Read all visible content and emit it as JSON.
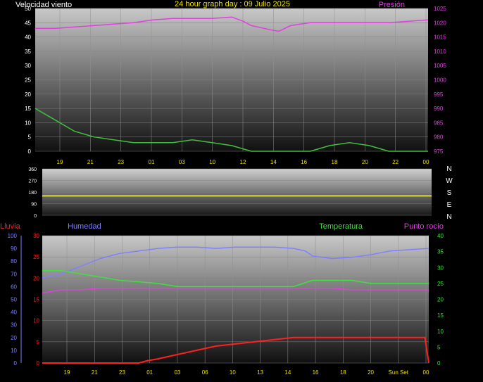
{
  "header": {
    "title": "24 hour graph day : 09 Julio 2025"
  },
  "colors": {
    "wind_label": "#ffffff",
    "pressure": "#e040e0",
    "tick_yellow": "#e8e000",
    "humidity": "#8080ff",
    "temperature": "#40e040",
    "dew": "#e040e0",
    "rain": "#ff2020",
    "direction": "#ffff60"
  },
  "x_ticks": [
    "19",
    "21",
    "23",
    "01",
    "03",
    "10",
    "12",
    "14",
    "16",
    "18",
    "20",
    "22",
    "00"
  ],
  "x_ticks_bottom": [
    "19",
    "21",
    "23",
    "01",
    "03",
    "06",
    "10",
    "13",
    "14",
    "16",
    "18",
    "20",
    "Sun Set",
    "00"
  ],
  "chart_data": [
    {
      "type": "line",
      "name": "wind_pressure",
      "left_label": "Velocidad viento",
      "right_label": "Presión",
      "left_ticks": [
        "0",
        "5",
        "10",
        "15",
        "20",
        "25",
        "30",
        "35",
        "40",
        "45",
        "50"
      ],
      "right_ticks": [
        "975",
        "980",
        "985",
        "990",
        "995",
        "1000",
        "1005",
        "1010",
        "1015",
        "1020",
        "1025"
      ],
      "ylim_left": [
        0,
        50
      ],
      "ylim_right": [
        975,
        1025
      ],
      "series": [
        {
          "axis": "right",
          "color": "#e040e0",
          "x": [
            0,
            0.05,
            0.1,
            0.15,
            0.2,
            0.25,
            0.3,
            0.35,
            0.4,
            0.45,
            0.5,
            0.53,
            0.55,
            0.6,
            0.62,
            0.65,
            0.7,
            0.72,
            0.75,
            0.8,
            0.85,
            0.9,
            0.95,
            1.0
          ],
          "values": [
            1018,
            1018,
            1018.5,
            1019,
            1019.5,
            1020,
            1021,
            1021.5,
            1021.5,
            1021.5,
            1022,
            1020.5,
            1019,
            1017.5,
            1017,
            1019,
            1020,
            1020,
            1020,
            1020,
            1020,
            1020,
            1020.5,
            1021
          ]
        },
        {
          "axis": "left",
          "color": "#40c040",
          "x": [
            0,
            0.05,
            0.1,
            0.15,
            0.2,
            0.25,
            0.3,
            0.35,
            0.4,
            0.45,
            0.5,
            0.55,
            0.6,
            0.65,
            0.7,
            0.75,
            0.8,
            0.85,
            0.9,
            0.95,
            1.0
          ],
          "values": [
            15,
            11,
            7,
            5,
            4,
            3,
            3,
            3,
            4,
            3,
            2,
            0,
            0,
            0,
            0,
            2,
            3,
            2,
            0,
            0,
            0
          ]
        }
      ]
    },
    {
      "type": "line",
      "name": "wind_direction",
      "left_ticks": [
        "0",
        "90",
        "180",
        "270",
        "360"
      ],
      "right_ticks": [
        "N",
        "W",
        "S",
        "E",
        "N"
      ],
      "ylim": [
        0,
        360
      ],
      "series": [
        {
          "color": "#ffff60",
          "x": [
            0,
            1
          ],
          "values": [
            150,
            150
          ]
        }
      ]
    },
    {
      "type": "line",
      "name": "humidity_temp_rain",
      "rain_label": "Lluvia",
      "humidity_label": "Humedad",
      "temp_label": "Temperatura",
      "dew_label": "Punto rocío",
      "rain_ticks": [
        "0",
        "5",
        "10",
        "15",
        "20",
        "25",
        "30"
      ],
      "humidity_ticks": [
        "0",
        "10",
        "20",
        "30",
        "40",
        "50",
        "60",
        "70",
        "80",
        "90",
        "100"
      ],
      "temp_ticks": [
        "0",
        "5",
        "10",
        "15",
        "20",
        "25",
        "30",
        "35",
        "40"
      ],
      "ylim_rain": [
        0,
        30
      ],
      "ylim_humidity": [
        0,
        100
      ],
      "ylim_temp": [
        0,
        40
      ],
      "series": [
        {
          "name": "Humedad",
          "axis": "humidity",
          "color": "#8080ff",
          "x": [
            0,
            0.05,
            0.1,
            0.15,
            0.2,
            0.25,
            0.3,
            0.35,
            0.4,
            0.45,
            0.5,
            0.55,
            0.6,
            0.65,
            0.68,
            0.7,
            0.75,
            0.8,
            0.85,
            0.9,
            0.95,
            1.0
          ],
          "values": [
            67,
            70,
            76,
            82,
            86,
            88,
            90,
            91,
            91,
            90,
            91,
            91,
            91,
            90,
            88,
            84,
            82,
            83,
            85,
            88,
            89,
            90
          ]
        },
        {
          "name": "Temperatura",
          "axis": "temp",
          "color": "#40e040",
          "x": [
            0,
            0.05,
            0.1,
            0.15,
            0.2,
            0.25,
            0.3,
            0.35,
            0.4,
            0.45,
            0.5,
            0.55,
            0.6,
            0.65,
            0.7,
            0.75,
            0.8,
            0.85,
            0.9,
            0.95,
            1.0
          ],
          "values": [
            29,
            29,
            28,
            27,
            26,
            25.5,
            25,
            24,
            24,
            24,
            24,
            24,
            24,
            24,
            26,
            26,
            26,
            25,
            25,
            25,
            25
          ]
        },
        {
          "name": "Punto rocío",
          "axis": "temp",
          "color": "#e040e0",
          "x": [
            0,
            0.05,
            0.1,
            0.15,
            0.2,
            0.25,
            0.3,
            0.35,
            0.4,
            0.45,
            0.5,
            0.55,
            0.6,
            0.65,
            0.7,
            0.75,
            0.8,
            0.85,
            0.9,
            0.95,
            1.0
          ],
          "values": [
            22,
            23,
            23,
            23.5,
            23.5,
            23.5,
            23.5,
            23.5,
            23.5,
            23.5,
            23.5,
            23.5,
            23.5,
            23.5,
            23.5,
            23.5,
            23,
            23,
            23,
            23,
            23
          ]
        },
        {
          "name": "Lluvia",
          "axis": "rain",
          "color": "#ff2020",
          "x": [
            0,
            0.25,
            0.27,
            0.3,
            0.35,
            0.4,
            0.45,
            0.5,
            0.55,
            0.6,
            0.65,
            0.7,
            0.8,
            0.9,
            0.99,
            1.0
          ],
          "values": [
            0,
            0,
            0.5,
            1,
            2,
            3,
            4,
            4.5,
            5,
            5.5,
            6,
            6,
            6,
            6,
            6,
            0
          ]
        }
      ]
    }
  ]
}
